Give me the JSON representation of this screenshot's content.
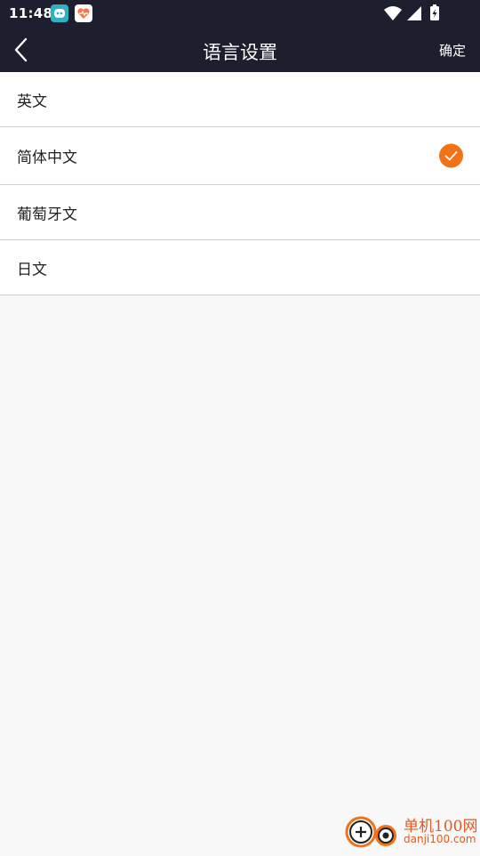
{
  "status_bar": {
    "time": "11:48",
    "notifications": [
      "robot-app-icon",
      "heart-app-icon"
    ],
    "icons": [
      "wifi-icon",
      "cell-signal-icon",
      "battery-charging-icon"
    ]
  },
  "header": {
    "title": "语言设置",
    "back_icon": "chevron-left-icon",
    "confirm_label": "确定",
    "background": "#1d1f2e"
  },
  "languages": [
    {
      "label": "英文",
      "selected": false
    },
    {
      "label": "简体中文",
      "selected": true
    },
    {
      "label": "葡萄牙文",
      "selected": false
    },
    {
      "label": "日文",
      "selected": false
    }
  ],
  "accent_color": "#f07317",
  "watermark": {
    "title": "单机100网",
    "url": "danji100.com"
  }
}
